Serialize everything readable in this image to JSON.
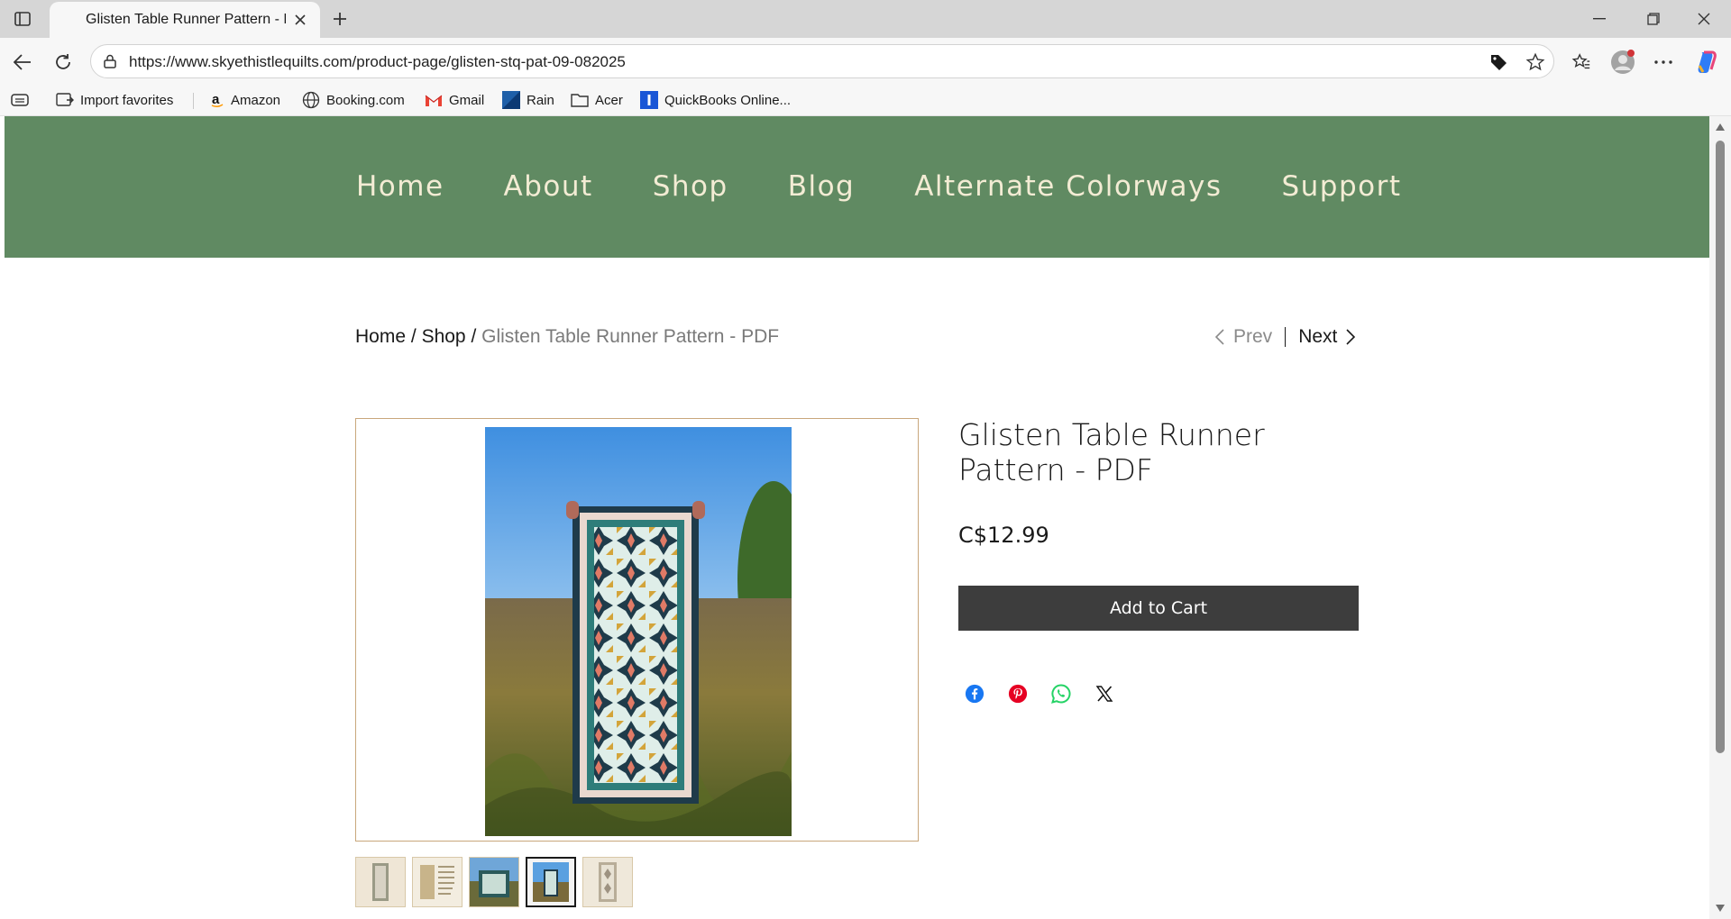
{
  "browser": {
    "tab_title": "Glisten Table Runner Pattern - PDF",
    "url": "https://www.skyethistlequilts.com/product-page/glisten-stq-pat-09-082025"
  },
  "favorites": [
    {
      "label": "Import favorites",
      "icon": "import-icon"
    },
    {
      "label": "Amazon",
      "icon": "amazon-icon"
    },
    {
      "label": "Booking.com",
      "icon": "globe-icon"
    },
    {
      "label": "Gmail",
      "icon": "gmail-icon"
    },
    {
      "label": "Rain",
      "icon": "rain-icon"
    },
    {
      "label": "Acer",
      "icon": "folder-icon"
    },
    {
      "label": "QuickBooks Online...",
      "icon": "quickbooks-icon"
    }
  ],
  "site": {
    "nav": [
      "Home",
      "About",
      "Shop",
      "Blog",
      "Alternate Colorways",
      "Support"
    ],
    "header_color": "#608a62",
    "nav_text_color": "#f3ecd4"
  },
  "breadcrumb": {
    "home": "Home",
    "shop": "Shop",
    "separator": "/",
    "current": "Glisten Table Runner Pattern - PDF"
  },
  "pager": {
    "prev": "Prev",
    "next": "Next"
  },
  "product": {
    "title": "Glisten Table Runner Pattern - PDF",
    "price": "C$12.99",
    "add_to_cart": "Add to Cart",
    "thumbnail_count": 5,
    "active_thumbnail": 4
  },
  "share": [
    "facebook-icon",
    "pinterest-icon",
    "whatsapp-icon",
    "x-icon"
  ]
}
